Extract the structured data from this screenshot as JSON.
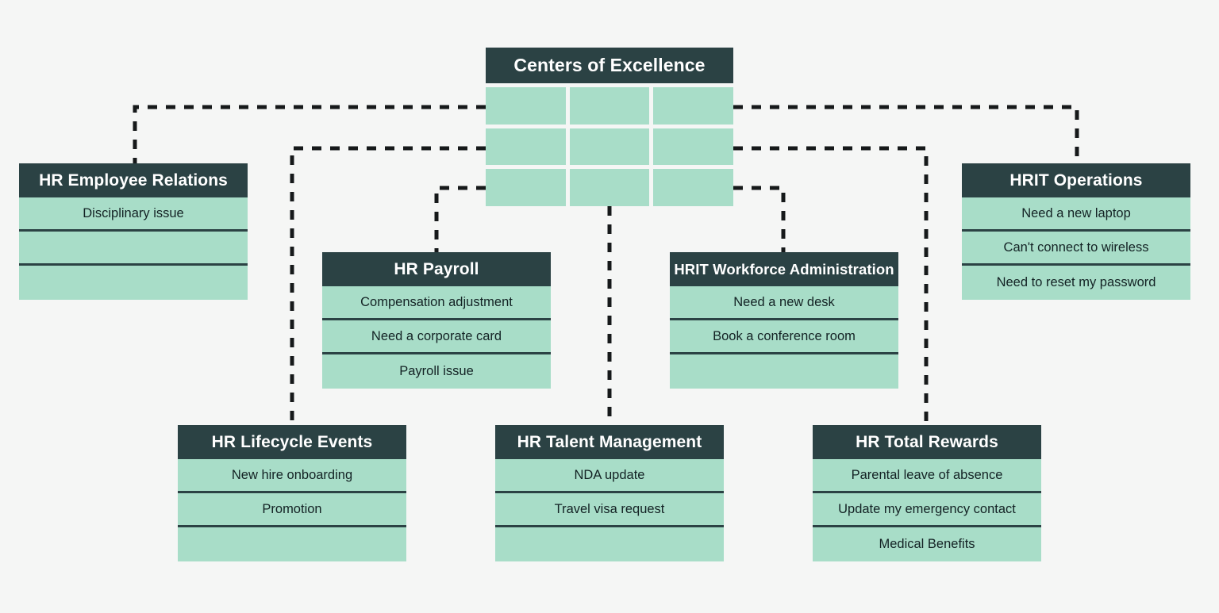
{
  "colors": {
    "background": "#f5f6f5",
    "header_dark": "#2b4244",
    "cell_green": "#a8ddc8",
    "text_dark": "#132224",
    "text_light": "#ffffff",
    "connector": "#16191a"
  },
  "center": {
    "title": "Centers of Excellence",
    "grid_rows": 3,
    "grid_cols": 3,
    "cells": [
      "",
      "",
      "",
      "",
      "",
      "",
      "",
      "",
      ""
    ]
  },
  "nodes": [
    {
      "id": "hr-employee-relations",
      "title": "HR Employee Relations",
      "items": [
        "Disciplinary issue",
        "",
        ""
      ]
    },
    {
      "id": "hrit-operations",
      "title": "HRIT Operations",
      "items": [
        "Need a new laptop",
        "Can't connect to wireless",
        "Need to reset my password"
      ]
    },
    {
      "id": "hr-payroll",
      "title": "HR Payroll",
      "items": [
        "Compensation adjustment",
        "Need a corporate card",
        "Payroll issue"
      ]
    },
    {
      "id": "hrit-workforce-administration",
      "title": "HRIT Workforce Administration",
      "items": [
        "Need a new desk",
        "Book a conference room",
        ""
      ]
    },
    {
      "id": "hr-lifecycle-events",
      "title": "HR Lifecycle Events",
      "items": [
        "New hire onboarding",
        "Promotion",
        ""
      ]
    },
    {
      "id": "hr-talent-management",
      "title": "HR Talent Management",
      "items": [
        "NDA update",
        "Travel visa request",
        ""
      ]
    },
    {
      "id": "hr-total-rewards",
      "title": "HR Total Rewards",
      "items": [
        "Parental leave of absence",
        "Update my emergency contact",
        "Medical Benefits"
      ]
    }
  ]
}
